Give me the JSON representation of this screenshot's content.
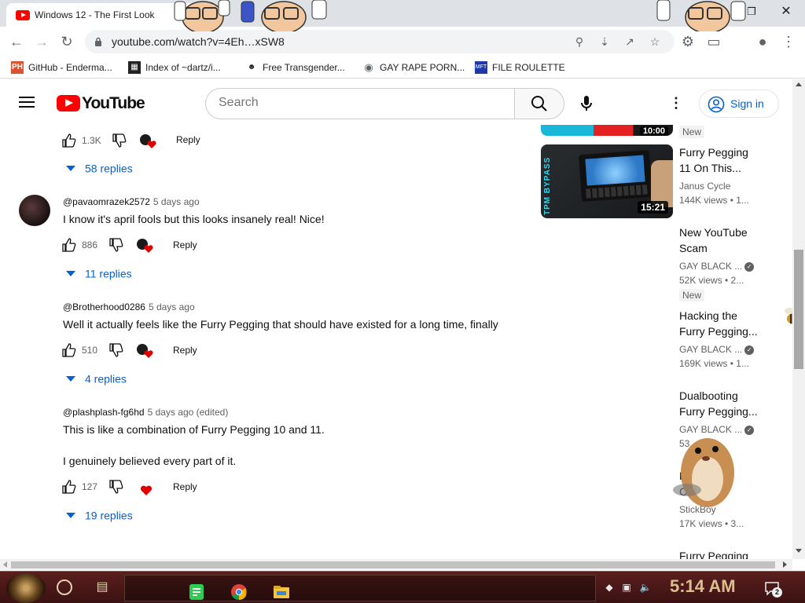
{
  "browser": {
    "tab_title": "Windows 12 - The First Look",
    "url": "youtube.com/watch?v=4Eh…xSW8",
    "window_controls": {
      "minimize": "–",
      "restore": "❐",
      "close": "✕"
    },
    "bookmarks": [
      {
        "label": "GitHub - Enderma...",
        "icon": "ph-icon"
      },
      {
        "label": "Index of ~dartz/i...",
        "icon": "index-icon"
      },
      {
        "label": "Free Transgender...",
        "icon": "face-icon"
      },
      {
        "label": "GAY RAPE PORN...",
        "icon": "globe-icon"
      },
      {
        "label": "FILE ROULETTE",
        "icon": "mft-icon"
      }
    ]
  },
  "youtube": {
    "wordmark": "YouTube",
    "search_placeholder": "Search",
    "sign_in": "Sign in"
  },
  "comments": {
    "top_partial": {
      "likes": "1.3K",
      "reply": "Reply",
      "replies": "58 replies"
    },
    "items": [
      {
        "author": "@pavaomrazek2572",
        "time": "5 days ago",
        "text": "I know it's april fools but this looks insanely real! Nice!",
        "likes": "886",
        "reply": "Reply",
        "replies": "11 replies"
      },
      {
        "author": "@Brotherhood0286",
        "time": "5 days ago",
        "text": "Well it actually feels like the Furry Pegging that should have existed for a long time, finally",
        "likes": "510",
        "reply": "Reply",
        "replies": "4 replies"
      },
      {
        "author": "@plashplash-fg6hd",
        "time": "5 days ago (edited)",
        "text": "This is like a combination of Furry Pegging 10 and 11.",
        "text2": "I genuinely believed every part of it.",
        "likes": "127",
        "reply": "Reply",
        "replies": "19 replies"
      }
    ]
  },
  "sidebar": {
    "partial_duration": "10:00",
    "new_badge": "New",
    "videos": [
      {
        "title1": "Furry Pegging",
        "title2": "11 On This...",
        "channel": "Janus Cycle",
        "meta": "144K views • 1...",
        "duration": "15:21",
        "thumb_text": "TPM BYPASS"
      },
      {
        "title1": "New YouTube",
        "title2": "Scam",
        "channel": "GAY BLACK ...",
        "meta": "52K views • 2...",
        "badge": "New"
      },
      {
        "title1": "Hacking the",
        "title2": "Furry Pegging...",
        "channel": "GAY BLACK ...",
        "meta": "169K views • 1..."
      },
      {
        "title1": "Dualbooting",
        "title2": "Furry Pegging...",
        "channel": "GAY BLACK ...",
        "meta": "53... • 1..."
      },
      {
        "title1": "Fu...ging",
        "title2": "Co...als",
        "channel": "StickBoy",
        "meta": "17K views • 3..."
      },
      {
        "title1": "Furry Pegging",
        "title2": ""
      }
    ]
  },
  "taskbar": {
    "clock": "5:14 AM",
    "notification_count": "2"
  },
  "colors": {
    "link_blue": "#065fd4",
    "youtube_red": "#ff0000",
    "taskbar": "#4a1818"
  }
}
